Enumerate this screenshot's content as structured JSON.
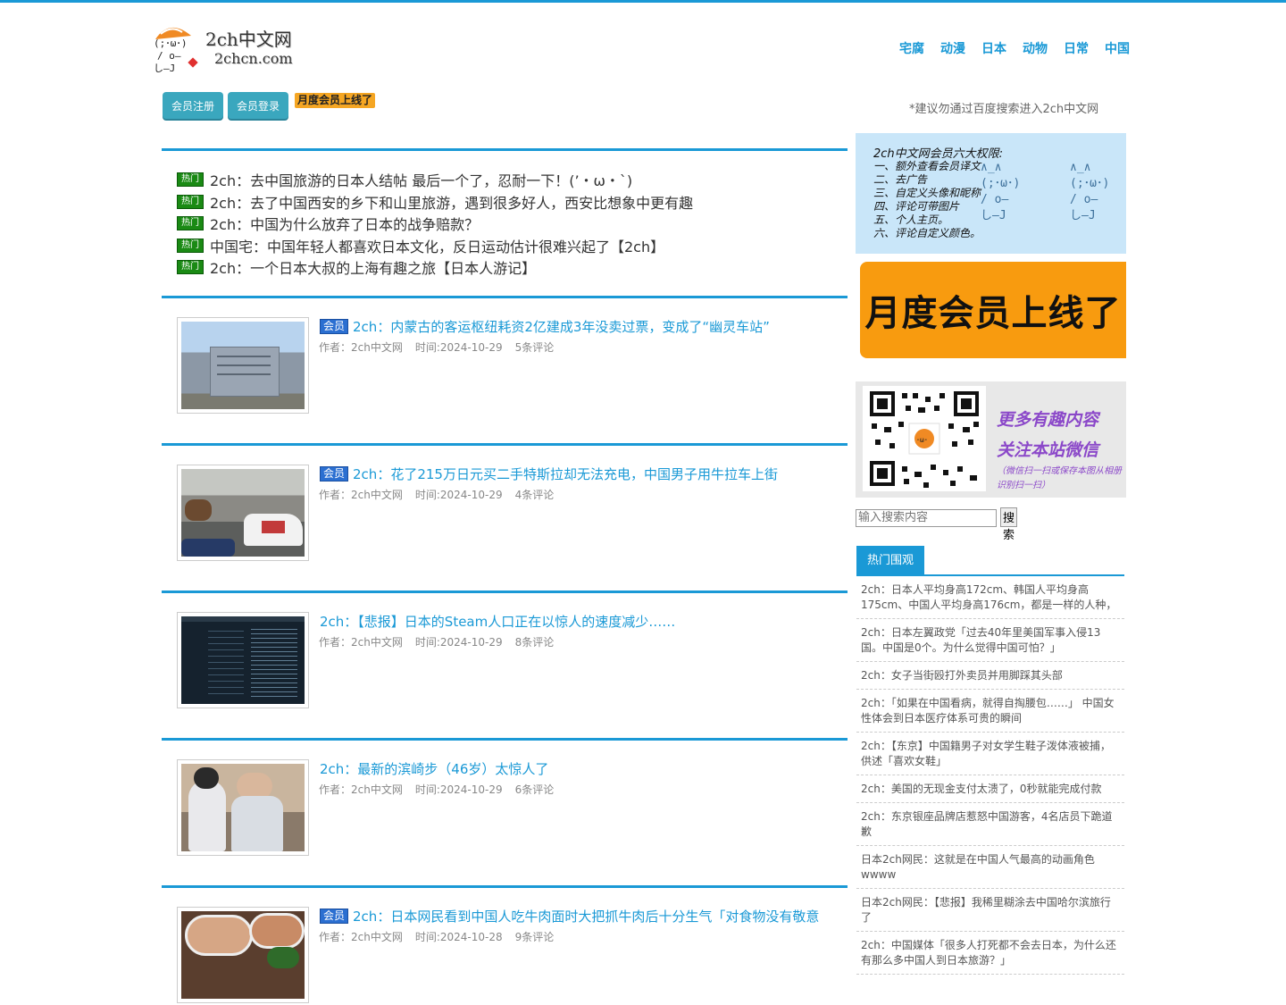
{
  "logo": {
    "brand_cn": "2ch中文网",
    "brand_domain": "2chcn.com"
  },
  "nav": [
    "宅腐",
    "动漫",
    "日本",
    "动物",
    "日常",
    "中国"
  ],
  "member": {
    "register": "会员注册",
    "login": "会员登录",
    "monthly_badge": "月度会员上线了"
  },
  "tip": "*建议勿通过百度搜索进入2ch中文网",
  "hot_tag": "热门",
  "hot_items": [
    "2ch：去中国旅游的日本人结帖 最后一个了，忍耐一下！(’・ω・`)",
    "2ch：去了中国西安的乡下和山里旅游，遇到很多好人，西安比想象中更有趣",
    "2ch：中国为什么放弃了日本的战争赔款？",
    "中国宅：中国年轻人都喜欢日本文化，反日运动估计很难兴起了【2ch】",
    "2ch：一个日本大叔的上海有趣之旅【日本人游记】"
  ],
  "vip_tag": "会员",
  "articles": [
    {
      "vip": true,
      "title": "2ch：内蒙古的客运枢纽耗资2亿建成3年没卖过票，变成了“幽灵车站”",
      "author": "作者：2ch中文网",
      "time": "时间:2024-10-29",
      "comments": "5条评论"
    },
    {
      "vip": true,
      "title": "2ch：花了215万日元买二手特斯拉却无法充电，中国男子用牛拉车上街",
      "author": "作者：2ch中文网",
      "time": "时间:2024-10-29",
      "comments": "4条评论"
    },
    {
      "vip": false,
      "title": "2ch：【悲报】日本的Steam人口正在以惊人的速度减少……",
      "author": "作者：2ch中文网",
      "time": "时间:2024-10-29",
      "comments": "8条评论"
    },
    {
      "vip": false,
      "title": "2ch：最新的滨崎步（46岁）太惊人了",
      "author": "作者：2ch中文网",
      "time": "时间:2024-10-29",
      "comments": "6条评论"
    },
    {
      "vip": true,
      "title": "2ch：日本网民看到中国人吃牛肉面时大把抓牛肉后十分生气「对食物没有敬意",
      "author": "作者：2ch中文网",
      "time": "时间:2024-10-28",
      "comments": "9条评论"
    }
  ],
  "perks": {
    "title": "2ch中文网会员六大权限:",
    "items": [
      "一、额外查看会员译文",
      "二、去广告",
      "三、自定义头像和昵称",
      "四、评论可带图片",
      "五、个人主页。",
      "六、评论自定义颜色。"
    ]
  },
  "monthly_banner": "月度会员上线了",
  "wechat": {
    "line1": "更多有趣内容",
    "line2": "关注本站微信",
    "line3": "（微信扫一扫或保存本图从相册识别扫一扫）"
  },
  "search": {
    "placeholder": "输入搜索内容",
    "button": "搜索"
  },
  "hot_watch": {
    "title": "热门围观",
    "items": [
      "2ch：日本人平均身高172cm、韩国人平均身高175cm、中国人平均身高176cm，都是一样的人种，",
      "2ch：日本左翼政党「过去40年里美国军事入侵13国。中国是0个。为什么觉得中国可怕？」",
      "2ch：女子当街殴打外卖员并用脚踩其头部",
      "2ch：「如果在中国看病，就得自掏腰包……」 中国女性体会到日本医疗体系可贵的瞬间",
      "2ch：【东京】中国籍男子对女学生鞋子泼体液被捕，供述「喜欢女鞋」",
      "2ch：美国的无现金支付太溃了，0秒就能完成付款",
      "2ch：东京银座品牌店惹怒中国游客，4名店员下跪道歉",
      "日本2ch网民：这就是在中国人气最高的动画角色wwww",
      "日本2ch网民：【悲报】我稀里糊涂去中国哈尔滨旅行了",
      "2ch：中国媒体「很多人打死都不会去日本，为什么还有那么多中国人到日本旅游？」"
    ]
  }
}
